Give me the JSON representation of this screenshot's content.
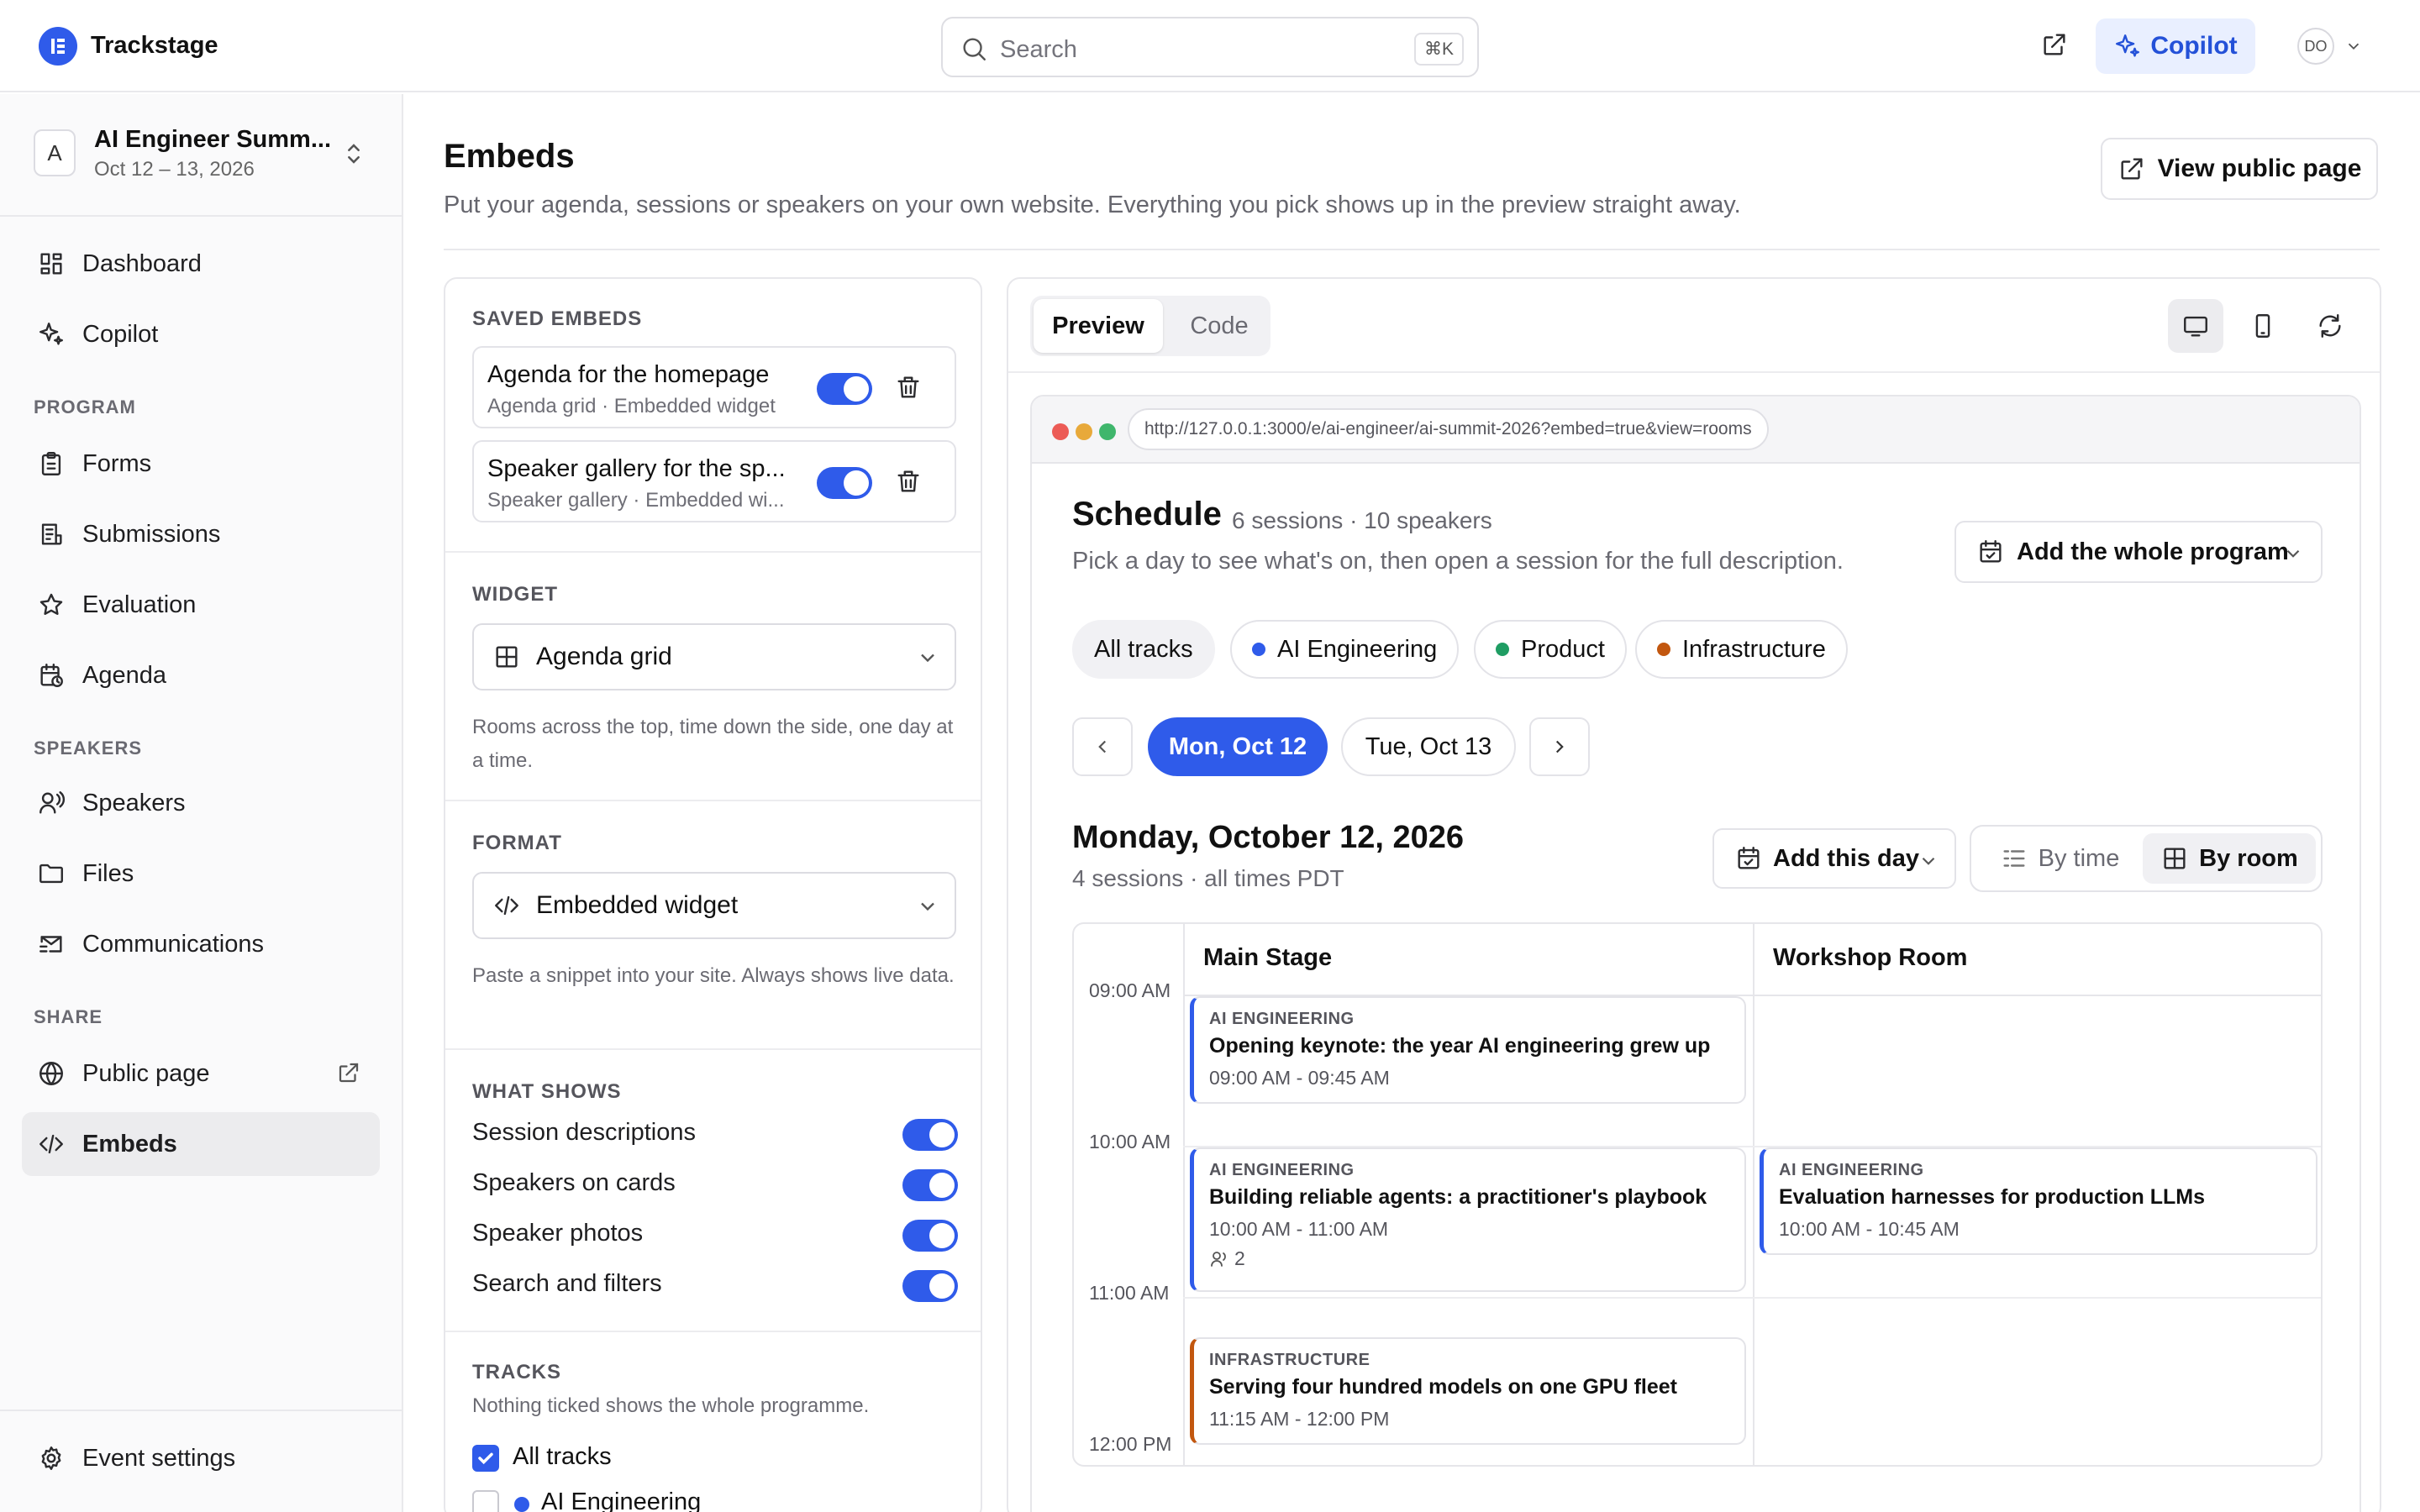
{
  "app": {
    "name": "Trackstage",
    "search_placeholder": "Search",
    "search_shortcut": "⌘K",
    "copilot_label": "Copilot",
    "avatar_initials": "DO"
  },
  "event": {
    "badge": "A",
    "name": "AI Engineer Summ...",
    "dates": "Oct 12 – 13, 2026"
  },
  "sidebar": {
    "items": [
      {
        "label": "Dashboard",
        "icon": "dashboard-icon"
      },
      {
        "label": "Copilot",
        "icon": "sparkles-icon"
      }
    ],
    "program_heading": "PROGRAM",
    "program": [
      {
        "label": "Forms",
        "icon": "clipboard-icon"
      },
      {
        "label": "Submissions",
        "icon": "document-list-icon"
      },
      {
        "label": "Evaluation",
        "icon": "star-icon"
      },
      {
        "label": "Agenda",
        "icon": "calendar-clock-icon"
      }
    ],
    "speakers_heading": "SPEAKERS",
    "speakers": [
      {
        "label": "Speakers",
        "icon": "speaker-icon"
      },
      {
        "label": "Files",
        "icon": "folder-icon"
      },
      {
        "label": "Communications",
        "icon": "mail-icon"
      }
    ],
    "share_heading": "SHARE",
    "share": [
      {
        "label": "Public page",
        "icon": "globe-icon"
      },
      {
        "label": "Embeds",
        "icon": "code-icon"
      }
    ],
    "footer": {
      "label": "Event settings",
      "icon": "gear-icon"
    }
  },
  "header": {
    "title": "Embeds",
    "subtitle": "Put your agenda, sessions or speakers on your own website. Everything you pick shows up in the preview straight away.",
    "view_public_label": "View public page"
  },
  "config": {
    "saved_heading": "SAVED EMBEDS",
    "saved": [
      {
        "title": "Agenda for the homepage",
        "subtitle": "Agenda grid · Embedded widget",
        "enabled": true
      },
      {
        "title": "Speaker gallery for the sp...",
        "subtitle": "Speaker gallery · Embedded wi...",
        "enabled": true
      }
    ],
    "widget_heading": "WIDGET",
    "widget_value": "Agenda grid",
    "widget_help": "Rooms across the top, time down the side, one day at a time.",
    "format_heading": "FORMAT",
    "format_value": "Embedded widget",
    "format_help": "Paste a snippet into your site. Always shows live data.",
    "shows_heading": "WHAT SHOWS",
    "shows": [
      {
        "label": "Session descriptions",
        "on": true
      },
      {
        "label": "Speakers on cards",
        "on": true
      },
      {
        "label": "Speaker photos",
        "on": true
      },
      {
        "label": "Search and filters",
        "on": true
      }
    ],
    "tracks_heading": "TRACKS",
    "tracks_help": "Nothing ticked shows the whole programme.",
    "tracks": [
      {
        "label": "All tracks",
        "checked": true
      },
      {
        "label": "AI Engineering",
        "checked": false,
        "color": "#2f5bea"
      }
    ]
  },
  "preview": {
    "tabs": [
      {
        "label": "Preview",
        "active": true
      },
      {
        "label": "Code",
        "active": false
      }
    ],
    "devices": [
      "desktop-icon",
      "mobile-icon",
      "refresh-icon"
    ],
    "url": "http://127.0.0.1:3000/e/ai-engineer/ai-summit-2026?embed=true&view=rooms",
    "schedule": {
      "title": "Schedule",
      "meta": "6 sessions · 10 speakers",
      "subtitle": "Pick a day to see what's on, then open a session for the full description.",
      "add_program_label": "Add the whole program",
      "tracks": [
        {
          "label": "All tracks",
          "active": true
        },
        {
          "label": "AI Engineering",
          "color": "#2f5bea"
        },
        {
          "label": "Product",
          "color": "#1f9d63"
        },
        {
          "label": "Infrastructure",
          "color": "#c2570f"
        }
      ],
      "days": [
        {
          "label": "Mon, Oct 12",
          "active": true
        },
        {
          "label": "Tue, Oct 13",
          "active": false
        }
      ],
      "day_title": "Monday, October 12, 2026",
      "day_meta": "4 sessions · all times PDT",
      "add_day_label": "Add this day",
      "view_by_time": "By time",
      "view_by_room": "By room",
      "rooms": [
        "Main Stage",
        "Workshop Room"
      ],
      "times": [
        "09:00 AM",
        "10:00 AM",
        "11:00 AM",
        "12:00 PM"
      ],
      "sessions": [
        {
          "track": "AI ENGINEERING",
          "title": "Opening keynote: the year AI engineering grew up",
          "time": "09:00 AM - 09:45 AM"
        },
        {
          "track": "AI ENGINEERING",
          "title": "Building reliable agents: a practitioner's playbook",
          "time": "10:00 AM - 11:00 AM",
          "speakers": "2"
        },
        {
          "track": "AI ENGINEERING",
          "title": "Evaluation harnesses for production LLMs",
          "time": "10:00 AM - 10:45 AM"
        },
        {
          "track": "INFRASTRUCTURE",
          "title": "Serving four hundred models on one GPU fleet",
          "time": "11:15 AM - 12:00 PM"
        }
      ]
    }
  }
}
